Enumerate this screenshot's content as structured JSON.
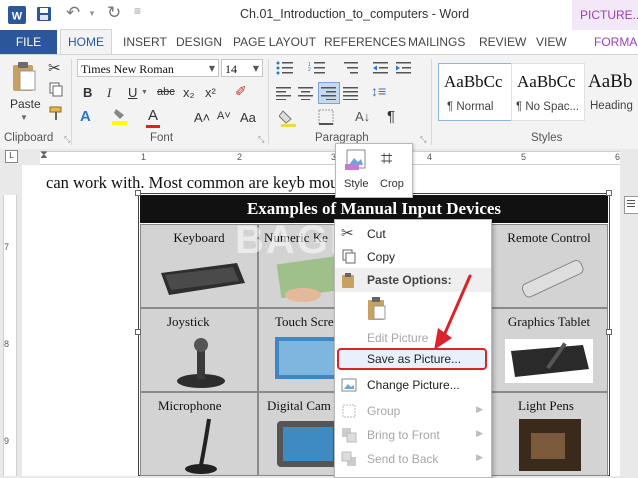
{
  "window": {
    "title": "Ch.01_Introduction_to_computers - Word",
    "context_tab": "PICTURE..."
  },
  "tabs": [
    "FILE",
    "HOME",
    "INSERT",
    "DESIGN",
    "PAGE LAYOUT",
    "REFERENCES",
    "MAILINGS",
    "REVIEW",
    "VIEW",
    "FORMA"
  ],
  "ribbon": {
    "clipboard": {
      "paste_label": "Paste",
      "group_label": "Clipboard"
    },
    "font": {
      "family": "Times New Roman",
      "size": "14",
      "group_label": "Font",
      "bold": "B",
      "italic": "I",
      "underline": "U",
      "strike": "abc",
      "sub": "x₂",
      "sup": "x²",
      "grow": "A˄",
      "shrink": "A˅",
      "case": "Aa"
    },
    "paragraph": {
      "group_label": "Paragraph"
    },
    "styles": {
      "group_label": "Styles",
      "items": [
        {
          "sample": "AaBbCc",
          "name": "¶ Normal"
        },
        {
          "sample": "AaBbCc",
          "name": "¶ No Spac..."
        },
        {
          "sample": "AaBb",
          "name": "Heading"
        }
      ]
    }
  },
  "ruler": {
    "h_numbers": [
      "1",
      "2",
      "3",
      "4",
      "5",
      "6"
    ],
    "v_numbers": [
      "7",
      "8",
      "9"
    ]
  },
  "document": {
    "text": "can work with. Most common are keyb         mouse",
    "picture": {
      "title": "Examples of Manual Input Devices",
      "cells": [
        "Keyboard",
        "Numeric Ke",
        "Remote Control",
        "Joystick",
        "Touch Scre",
        "Graphics Tablet",
        "Microphone",
        "Digital Cam",
        "Light Pens"
      ],
      "watermark": "BAGITEKNO"
    }
  },
  "mini_toolbar": {
    "style_label": "Style",
    "crop_label": "Crop"
  },
  "context_menu": {
    "items": [
      {
        "label": "Cut",
        "enabled": true
      },
      {
        "label": "Copy",
        "enabled": true
      },
      {
        "label": "Paste Options:",
        "enabled": true
      },
      {
        "label": "Edit Picture",
        "enabled": false
      },
      {
        "label": "Save as Picture...",
        "enabled": true,
        "highlighted": true
      },
      {
        "label": "Change Picture...",
        "enabled": true
      },
      {
        "label": "Group",
        "enabled": false
      },
      {
        "label": "Bring to Front",
        "enabled": false
      },
      {
        "label": "Send to Back",
        "enabled": false
      }
    ]
  },
  "colors": {
    "word_blue": "#2b579a",
    "picture_tools": "#9b3fba",
    "annotation": "#d9232d"
  }
}
